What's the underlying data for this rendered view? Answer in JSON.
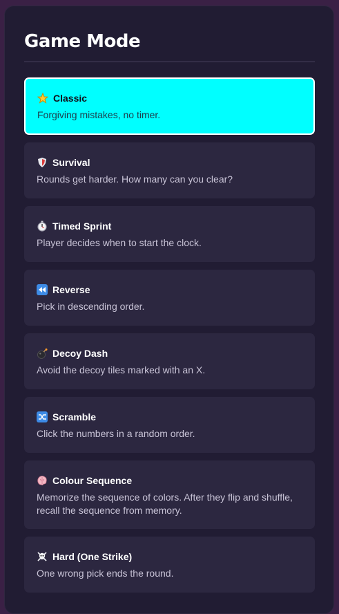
{
  "panel": {
    "title": "Game Mode"
  },
  "modes": [
    {
      "name": "Classic",
      "description": "Forgiving mistakes, no timer.",
      "icon": "star-icon",
      "selected": true
    },
    {
      "name": "Survival",
      "description": "Rounds get harder. How many can you clear?",
      "icon": "shield-icon",
      "selected": false
    },
    {
      "name": "Timed Sprint",
      "description": "Player decides when to start the clock.",
      "icon": "stopwatch-icon",
      "selected": false
    },
    {
      "name": "Reverse",
      "description": "Pick in descending order.",
      "icon": "rewind-icon",
      "selected": false
    },
    {
      "name": "Decoy Dash",
      "description": "Avoid the decoy tiles marked with an X.",
      "icon": "bomb-icon",
      "selected": false
    },
    {
      "name": "Scramble",
      "description": "Click the numbers in a random order.",
      "icon": "shuffle-icon",
      "selected": false
    },
    {
      "name": "Colour Sequence",
      "description": "Memorize the sequence of colors. After they flip and shuffle, recall the sequence from memory.",
      "icon": "brain-icon",
      "selected": false
    },
    {
      "name": "Hard (One Strike)",
      "description": "One wrong pick ends the round.",
      "icon": "skull-crossbones-icon",
      "selected": false
    }
  ],
  "colors": {
    "page_background": "#3a2045",
    "panel_background": "#211c33",
    "card_background": "#2c2740",
    "selected_card_background": "#00ffff"
  }
}
